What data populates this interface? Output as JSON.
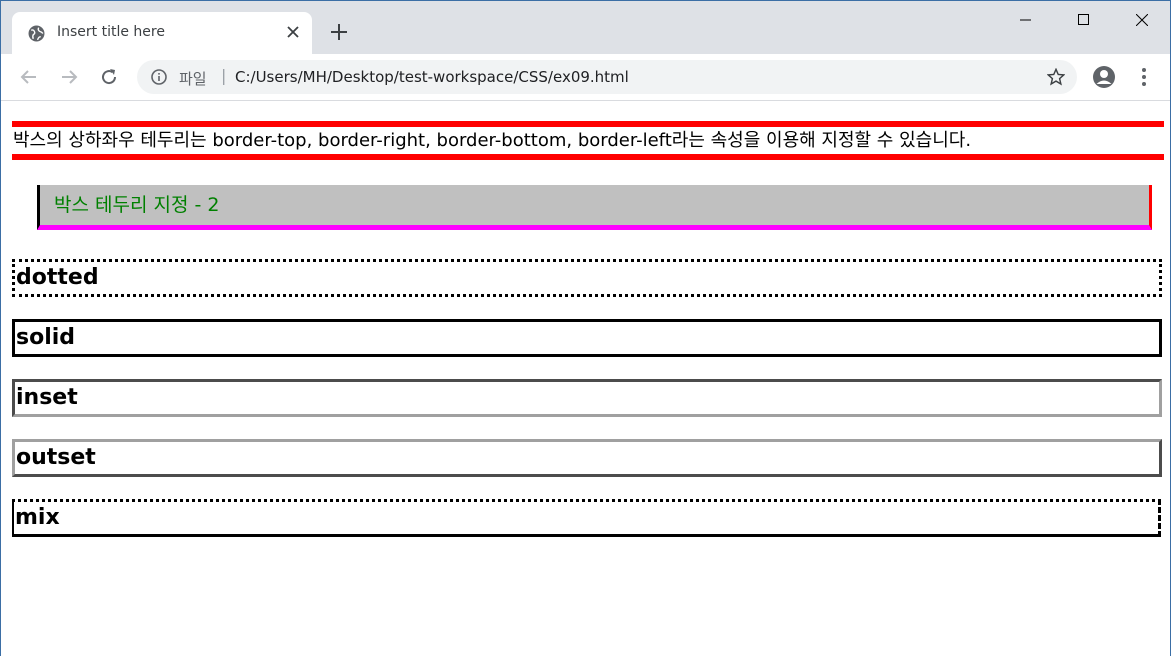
{
  "browser": {
    "tab": {
      "title": "Insert title here"
    },
    "address_bar": {
      "scheme_label": "파일",
      "separator": "|",
      "url": "C:/Users/MH/Desktop/test-workspace/CSS/ex09.html"
    }
  },
  "page": {
    "intro_text": "박스의 상하좌우 테두리는 border-top, border-right, border-bottom, border-left라는 속성을 이용해 지정할 수 있습니다.",
    "box_title": "박스 테두리 지정 - 2",
    "border_examples": [
      "dotted",
      "solid",
      "inset",
      "outset",
      "mix"
    ]
  },
  "colors": {
    "intro_border": "#ff0000",
    "box_background": "#c0c0c0",
    "box_text": "#008000",
    "box_left_border": "#000000",
    "box_right_border": "#ff0000",
    "box_bottom_border": "#ff00ff"
  },
  "icons": {
    "favicon": "globe-icon",
    "tab_close": "close-icon",
    "new_tab": "plus-icon",
    "minimize": "minimize-icon",
    "maximize": "maximize-icon",
    "window_close": "close-icon",
    "back": "back-arrow-icon",
    "forward": "forward-arrow-icon",
    "reload": "reload-icon",
    "site_info": "info-icon",
    "bookmark": "star-icon",
    "profile": "profile-icon",
    "menu": "more-vertical-icon"
  }
}
